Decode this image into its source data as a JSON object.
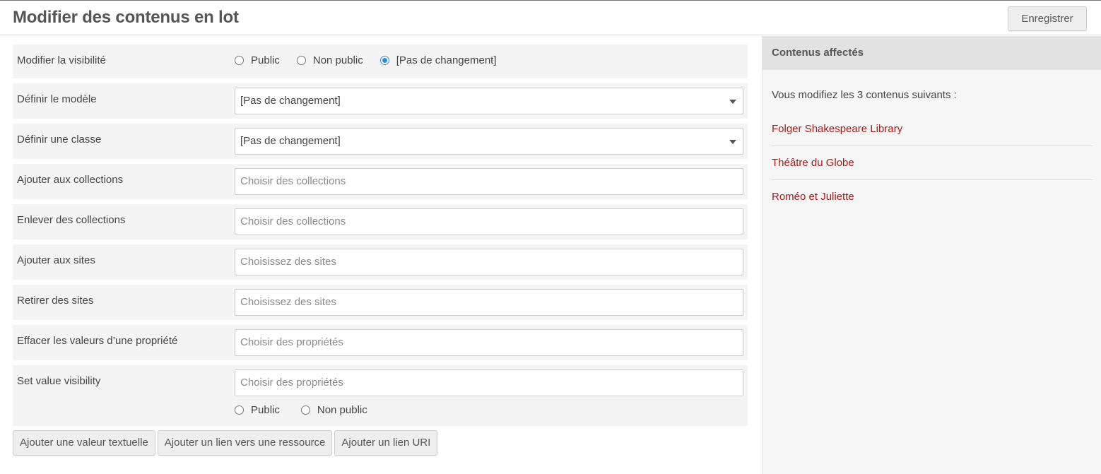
{
  "header": {
    "title": "Modifier des contenus en lot",
    "save_label": "Enregistrer"
  },
  "form": {
    "visibility": {
      "label": "Modifier la visibilité",
      "options": [
        "Public",
        "Non public",
        "[Pas de changement]"
      ],
      "selected": "[Pas de changement]"
    },
    "template": {
      "label": "Définir le modèle",
      "value": "[Pas de changement]"
    },
    "class": {
      "label": "Définir une classe",
      "value": "[Pas de changement]"
    },
    "add_collections": {
      "label": "Ajouter aux collections",
      "placeholder": "Choisir des collections"
    },
    "remove_collections": {
      "label": "Enlever des collections",
      "placeholder": "Choisir des collections"
    },
    "add_sites": {
      "label": "Ajouter aux sites",
      "placeholder": "Choisissez des sites"
    },
    "remove_sites": {
      "label": "Retirer des sites",
      "placeholder": "Choisissez des sites"
    },
    "clear_values": {
      "label": "Effacer les valeurs d’une propriété",
      "placeholder": "Choisir des propriétés"
    },
    "value_visibility": {
      "label": "Set value visibility",
      "placeholder": "Choisir des propriétés",
      "options": [
        "Public",
        "Non public"
      ]
    }
  },
  "actions": {
    "add_text": "Ajouter une valeur textuelle",
    "add_resource_link": "Ajouter un lien vers une ressource",
    "add_uri_link": "Ajouter un lien URI"
  },
  "sidebar": {
    "title": "Contenus affectés",
    "intro": "Vous modifiez les 3 contenus suivants :",
    "items": [
      "Folger Shakespeare Library",
      "Théâtre du Globe",
      "Roméo et Juliette"
    ]
  },
  "colors": {
    "accent_link": "#a91919",
    "radio_selected": "#2d8ce0"
  }
}
